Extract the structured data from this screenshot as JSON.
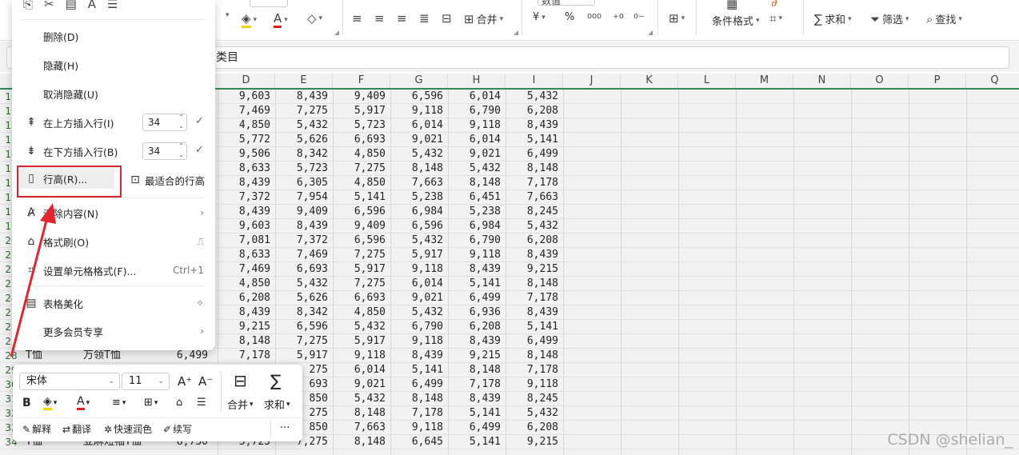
{
  "ribbon": {
    "font_size_value": "11",
    "number_format_value": "数值",
    "merge_label": "合并",
    "conditional_format_label": "条件格式",
    "sum_label": "求和",
    "filter_label": "筛选",
    "find_label": "查找",
    "percent_label": "%",
    "currency_label": "¥"
  },
  "formula_bar": {
    "value": "类目"
  },
  "columns": [
    "D",
    "E",
    "F",
    "G",
    "H",
    "I",
    "J",
    "K",
    "L",
    "M",
    "N",
    "O",
    "P",
    "Q"
  ],
  "row_numbers": [
    "10",
    "11",
    "12",
    "13",
    "14",
    "15",
    "16",
    "17",
    "18",
    "19",
    "20",
    "21",
    "22",
    "23",
    "24",
    "25",
    "26",
    "27",
    "28",
    "29",
    "30",
    "31",
    "32",
    "33",
    "34"
  ],
  "table_rows": [
    [
      "9,603",
      "8,439",
      "9,409",
      "6,596",
      "6,014",
      "5,432"
    ],
    [
      "7,469",
      "7,275",
      "5,917",
      "9,118",
      "6,790",
      "6,208"
    ],
    [
      "4,850",
      "5,432",
      "5,723",
      "6,014",
      "9,118",
      "8,439"
    ],
    [
      "5,772",
      "5,626",
      "6,693",
      "9,021",
      "6,014",
      "5,141"
    ],
    [
      "9,506",
      "8,342",
      "4,850",
      "5,432",
      "9,021",
      "6,499"
    ],
    [
      "8,633",
      "5,723",
      "7,275",
      "8,148",
      "5,432",
      "8,148"
    ],
    [
      "8,439",
      "6,305",
      "4,850",
      "7,663",
      "8,148",
      "7,178"
    ],
    [
      "7,372",
      "7,954",
      "5,141",
      "5,238",
      "6,451",
      "7,663"
    ],
    [
      "8,439",
      "9,409",
      "6,596",
      "6,984",
      "5,238",
      "8,245"
    ],
    [
      "9,603",
      "8,439",
      "9,409",
      "6,596",
      "6,984",
      "5,432"
    ],
    [
      "7,081",
      "7,372",
      "6,596",
      "5,432",
      "6,790",
      "6,208"
    ],
    [
      "8,633",
      "7,469",
      "7,275",
      "5,917",
      "9,118",
      "8,439"
    ],
    [
      "7,469",
      "6,693",
      "5,917",
      "9,118",
      "8,439",
      "9,215"
    ],
    [
      "4,850",
      "5,432",
      "7,275",
      "6,014",
      "5,141",
      "8,148"
    ],
    [
      "6,208",
      "5,626",
      "6,693",
      "9,021",
      "6,499",
      "7,178"
    ],
    [
      "8,439",
      "8,342",
      "4,850",
      "5,432",
      "6,936",
      "8,439"
    ],
    [
      "9,215",
      "6,596",
      "5,432",
      "6,790",
      "6,208",
      "5,141"
    ],
    [
      "8,148",
      "7,275",
      "5,917",
      "9,118",
      "8,439",
      "6,499"
    ],
    [
      "7,178",
      "5,917",
      "9,118",
      "8,439",
      "9,215",
      "8,148"
    ],
    [
      "",
      "275",
      "6,014",
      "5,141",
      "8,148",
      "7,178"
    ],
    [
      "",
      "693",
      "9,021",
      "6,499",
      "7,178",
      "9,118"
    ],
    [
      "",
      "850",
      "5,432",
      "8,148",
      "8,439",
      "8,245"
    ],
    [
      "",
      "275",
      "8,148",
      "7,178",
      "5,141",
      "5,432"
    ],
    [
      "",
      "850",
      "7,663",
      "9,118",
      "6,499",
      "6,208"
    ],
    [
      "5,723",
      "7,275",
      "8,148",
      "6,645",
      "5,141",
      "9,215"
    ]
  ],
  "row28_prefix": {
    "b": "T恤",
    "c": "万领T恤",
    "c_val": "6,499"
  },
  "row34_prefix": {
    "b": "T恤",
    "c": "亚麻短袖T恤",
    "c_val": "8,730"
  },
  "context_menu": {
    "delete": "删除(D)",
    "hide": "隐藏(H)",
    "unhide": "取消隐藏(U)",
    "insert_above": "在上方插入行(I)",
    "insert_above_count": "34",
    "insert_below": "在下方插入行(B)",
    "insert_below_count": "34",
    "row_height": "行高(R)...",
    "best_fit_row_height": "最适合的行高",
    "clear_content": "清除内容(N)",
    "format_painter": "格式刷(O)",
    "format_cells": "设置单元格格式(F)...",
    "format_cells_shortcut": "Ctrl+1",
    "beautify": "表格美化",
    "member": "更多会员专享"
  },
  "mini_toolbar": {
    "font_name": "宋体",
    "font_size": "11",
    "bold": "B",
    "merge": "合并",
    "sum": "求和",
    "explain": "解释",
    "translate": "翻译",
    "quick_polish": "快速润色",
    "continue_write": "续写",
    "more": "···"
  },
  "watermark": "CSDN @shelian_",
  "colors": {
    "accent": "#2e8b57",
    "highlight_box": "#d9262e",
    "arrow": "#e3262e"
  }
}
